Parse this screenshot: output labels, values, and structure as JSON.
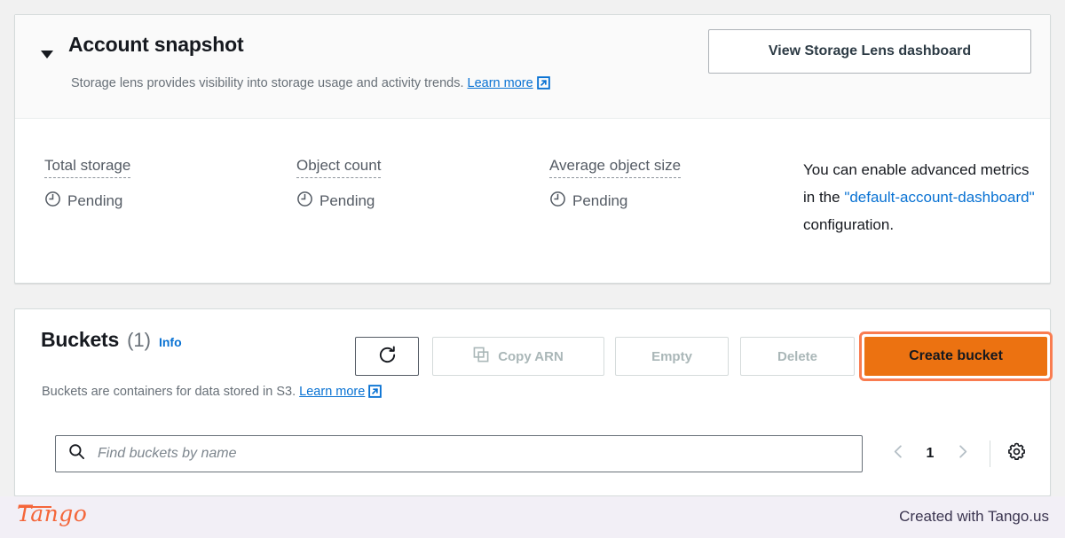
{
  "snapshot": {
    "title": "Account snapshot",
    "caret_icon": "caret-down-icon",
    "description": "Storage lens provides visibility into storage usage and activity trends.",
    "learn_more": "Learn more",
    "view_dashboard_button": "View Storage Lens dashboard",
    "metrics": [
      {
        "label": "Total storage",
        "value": "Pending",
        "icon": "clock-icon"
      },
      {
        "label": "Object count",
        "value": "Pending",
        "icon": "clock-icon"
      },
      {
        "label": "Average object size",
        "value": "Pending",
        "icon": "clock-icon"
      }
    ],
    "advanced_note": {
      "lead": "You can enable advanced metrics in the ",
      "link": "\"default-account-dashboard\"",
      "tail": " configuration."
    }
  },
  "buckets": {
    "title": "Buckets",
    "count": "(1)",
    "info_link": "Info",
    "description": "Buckets are containers for data stored in S3.",
    "learn_more": "Learn more",
    "toolbar": {
      "refresh_icon": "refresh-icon",
      "copy_arn": "Copy ARN",
      "copy_icon": "copy-icon",
      "empty": "Empty",
      "delete": "Delete",
      "create_bucket": "Create bucket"
    },
    "search": {
      "placeholder": "Find buckets by name",
      "value": "",
      "icon": "search-icon"
    },
    "pagination": {
      "prev_icon": "chevron-left-icon",
      "page": "1",
      "next_icon": "chevron-right-icon",
      "settings_icon": "gear-icon"
    }
  },
  "footer": {
    "logo": "Tango",
    "credit": "Created with Tango.us"
  },
  "colors": {
    "page_background": "#f1f1f1",
    "card_background": "#ffffff",
    "primary_orange": "#ec7211",
    "highlight_ring": "#f97c50",
    "link_blue": "#0972d3",
    "muted_text": "#687078",
    "disabled_text": "#aab7b8",
    "footer_background": "#f2eff6",
    "tango_orange": "#f4663a"
  }
}
